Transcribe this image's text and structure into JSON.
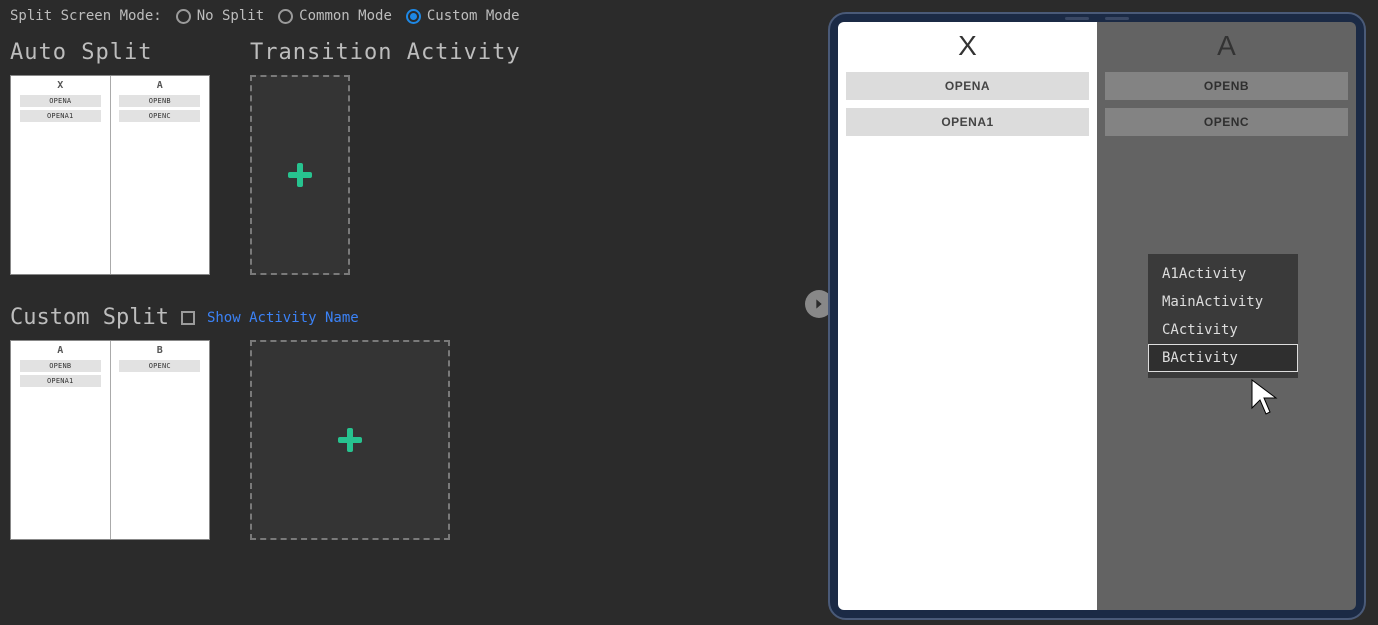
{
  "mode_row": {
    "label": "Split Screen Mode:",
    "options": {
      "no_split": "No Split",
      "common": "Common Mode",
      "custom": "Custom Mode"
    },
    "selected": "custom"
  },
  "sections": {
    "auto_split": {
      "title": "Auto Split"
    },
    "transition": {
      "title": "Transition Activity"
    },
    "custom_split": {
      "title": "Custom Split",
      "checkbox_label": "Show Activity Name"
    }
  },
  "auto_split_preview": {
    "left": {
      "title": "X",
      "rows": [
        "OPENA",
        "OPENA1"
      ]
    },
    "right": {
      "title": "A",
      "rows": [
        "OPENB",
        "OPENC"
      ]
    }
  },
  "custom_split_preview": {
    "left": {
      "title": "A",
      "rows": [
        "OPENB",
        "OPENA1"
      ]
    },
    "right": {
      "title": "B",
      "rows": [
        "OPENC"
      ]
    }
  },
  "device": {
    "left": {
      "title": "X",
      "rows": [
        "OPENA",
        "OPENA1"
      ]
    },
    "right": {
      "title": "A",
      "rows": [
        "OPENB",
        "OPENC"
      ]
    }
  },
  "context_menu": {
    "items": [
      "A1Activity",
      "MainActivity",
      "CActivity",
      "BActivity"
    ],
    "highlighted_index": 3
  }
}
